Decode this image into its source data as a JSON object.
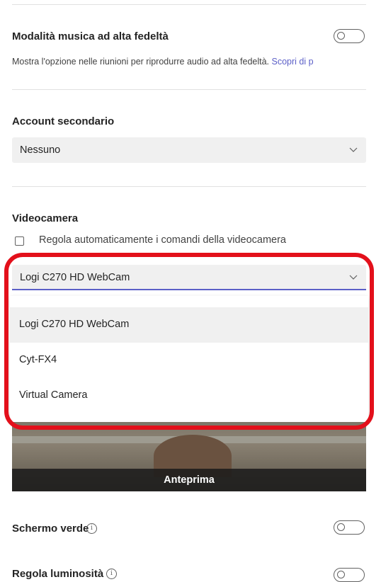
{
  "hifi": {
    "title": "Modalità musica ad alta fedeltà",
    "description": "Mostra l'opzione nelle riunioni per riprodurre audio ad alta fedeltà.",
    "link": "Scopri di p"
  },
  "secondary_account": {
    "title": "Account secondario",
    "value": "Nessuno"
  },
  "camera": {
    "title": "Videocamera",
    "auto_adjust_label": "Regola automaticamente i comandi della videocamera",
    "selected": "Logi C270 HD WebCam",
    "options": [
      "Logi C270 HD WebCam",
      "Cyt-FX4",
      "Virtual Camera"
    ],
    "preview_label": "Anteprima"
  },
  "green_screen": {
    "title": "Schermo verde",
    "info_icon": "i"
  },
  "brightness": {
    "title": "Regola luminosità",
    "info_icon": "i"
  },
  "colors": {
    "accent": "#5b5fc7",
    "highlight": "#e3101b"
  }
}
